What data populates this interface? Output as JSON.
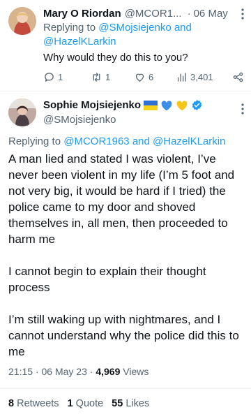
{
  "reply_tweet": {
    "display_name": "Mary O Riordan",
    "handle": "@MCOR1...",
    "separator": "·",
    "date": "06 May",
    "replying_prefix": "Replying to",
    "replying_to_1": "@SMojsiejenko",
    "replying_and": "and",
    "replying_to_2": "@HazelKLarkin",
    "text": "Why would they do this to you?",
    "reply_count": "1",
    "retweet_count": "1",
    "like_count": "6",
    "view_count": "3,401"
  },
  "main_tweet": {
    "display_name": "Sophie Mojsiejenko",
    "handle": "@SMojsiejenko",
    "replying_prefix": "Replying to",
    "replying_to_1": "@MCOR1963",
    "replying_and": "and",
    "replying_to_2": "@HazelKLarkin",
    "paragraphs": [
      "A man lied and stated I was violent, I’ve never been violent in my life (I’m 5 foot and not very big, it would be hard if I tried) the police came to my door and shoved themselves in, all men, then proceeded to harm me",
      "I cannot begin to explain their thought process",
      "I’m still waking up with nightmares, and I cannot understand why the police did this to me"
    ],
    "time": "21:15",
    "separator": "·",
    "date": "06 May 23",
    "views_count": "4,969",
    "views_label": "Views",
    "retweets_count": "8",
    "retweets_label": "Retweets",
    "quotes_count": "1",
    "quotes_label": "Quote",
    "likes_count": "55",
    "likes_label": "Likes"
  },
  "colors": {
    "accent": "#1d9bf0",
    "muted": "#536471",
    "text": "#0f1419",
    "divider": "#eff3f4"
  }
}
